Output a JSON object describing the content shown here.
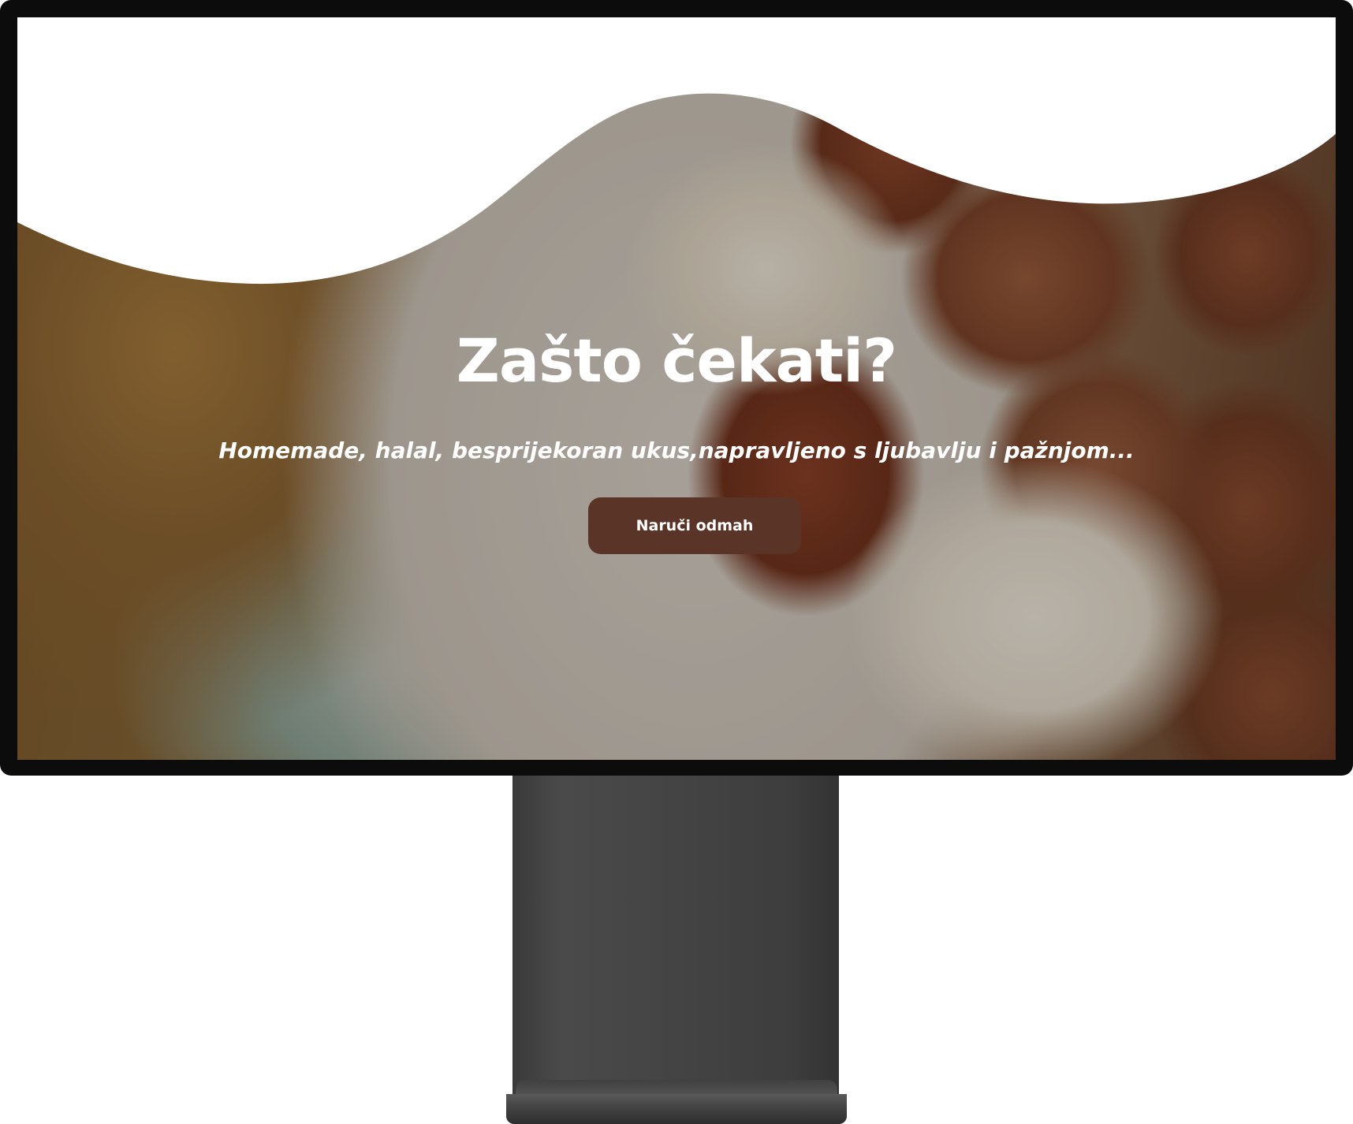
{
  "hero": {
    "title": "Zašto čekati?",
    "subtitle": "Homemade, halal, besprijekoran ukus,napravljeno s ljubavlju i pažnjom...",
    "button_label": "Naruči odmah"
  },
  "colors": {
    "button_background": "#5a3427",
    "button_text": "#ffffff",
    "wave_fill": "#ffffff",
    "bezel": "#0c0c0c",
    "stand": "#444444"
  },
  "decor": {
    "hero_image": "chocolate-pralines-photo",
    "device_frame": "desktop-monitor-icon"
  }
}
